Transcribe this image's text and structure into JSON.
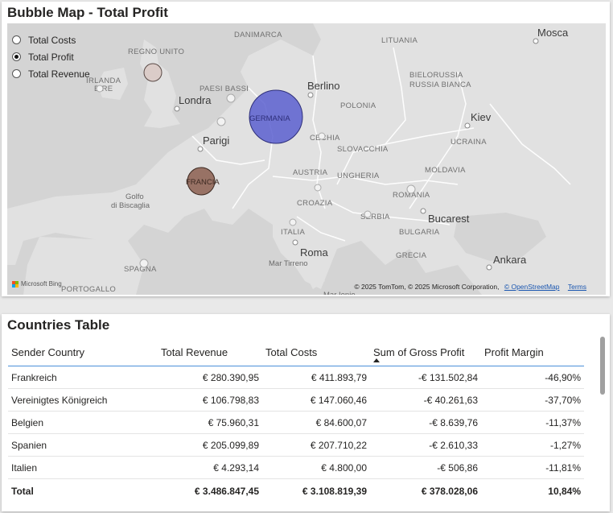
{
  "map_visual": {
    "title": "Bubble Map - Total Profit",
    "legend": [
      {
        "label": "Total Costs",
        "selected": false
      },
      {
        "label": "Total Profit",
        "selected": true
      },
      {
        "label": "Total Revenue",
        "selected": false
      }
    ],
    "bubbles": [
      {
        "label": "GERMANIA",
        "color": "#5a5fcf"
      },
      {
        "label": "FRANCIA",
        "color": "#8b5e4f"
      },
      {
        "label": "",
        "color": "#d9c7c2"
      }
    ],
    "cities": [
      "Mosca",
      "Berlino",
      "Londra",
      "Parigi",
      "Kiev",
      "Bucarest",
      "Roma",
      "Ankara"
    ],
    "countries": [
      "DANIMARCA",
      "LITUANIA",
      "REGNO UNITO",
      "IRLANDA",
      "EIRE",
      "PAESI BASSI",
      "BIELORUSSIA",
      "RUSSIA BIANCA",
      "POLONIA",
      "CECHIA",
      "UCRAINA",
      "SLOVACCHIA",
      "MOLDAVIA",
      "AUSTRIA",
      "UNGHERIA",
      "ROMANIA",
      "CROAZIA",
      "SERBIA",
      "BULGARIA",
      "ITALIA",
      "GRECIA",
      "SPAGNA",
      "PORTOGALLO"
    ],
    "seas": [
      "Golfo",
      "di Biscaglia",
      "Mar Tirreno",
      "Mar Ionio"
    ],
    "bing_label": "Microsoft Bing",
    "copyright_text": "© 2025 TomTom, © 2025 Microsoft Corporation,",
    "osm_link": "© OpenStreetMap",
    "terms_link": "Terms"
  },
  "table_visual": {
    "title": "Countries Table",
    "columns": [
      "Sender Country",
      "Total Revenue",
      "Total Costs",
      "Sum of Gross Profit",
      "Profit Margin"
    ],
    "rows": [
      {
        "country": "Frankreich",
        "revenue": "€ 280.390,95",
        "costs": "€ 411.893,79",
        "profit": "-€ 131.502,84",
        "margin": "-46,90%"
      },
      {
        "country": "Vereinigtes Königreich",
        "revenue": "€ 106.798,83",
        "costs": "€ 147.060,46",
        "profit": "-€ 40.261,63",
        "margin": "-37,70%"
      },
      {
        "country": "Belgien",
        "revenue": "€ 75.960,31",
        "costs": "€ 84.600,07",
        "profit": "-€ 8.639,76",
        "margin": "-11,37%"
      },
      {
        "country": "Spanien",
        "revenue": "€ 205.099,89",
        "costs": "€ 207.710,22",
        "profit": "-€ 2.610,33",
        "margin": "-1,27%"
      },
      {
        "country": "Italien",
        "revenue": "€ 4.293,14",
        "costs": "€ 4.800,00",
        "profit": "-€ 506,86",
        "margin": "-11,81%"
      }
    ],
    "total": {
      "label": "Total",
      "revenue": "€ 3.486.847,45",
      "costs": "€ 3.108.819,39",
      "profit": "€ 378.028,06",
      "margin": "10,84%"
    }
  }
}
